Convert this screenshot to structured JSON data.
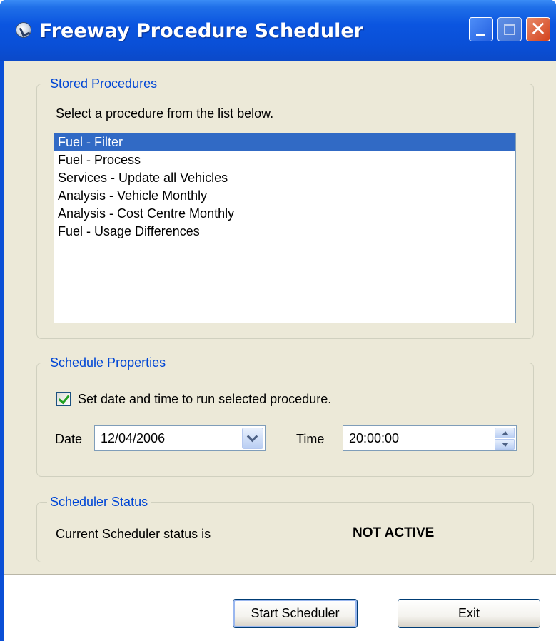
{
  "window": {
    "title": "Freeway Procedure Scheduler",
    "icon": "app-icon",
    "controls": {
      "minimize": "minimize-icon",
      "maximize": "maximize-icon",
      "close": "✕"
    }
  },
  "stored_procedures": {
    "legend": "Stored Procedures",
    "instruction": "Select a procedure from the list below.",
    "items": [
      "Fuel - Filter",
      "Fuel - Process",
      "Services - Update all Vehicles",
      "Analysis - Vehicle Monthly",
      "Analysis - Cost Centre Monthly",
      "Fuel - Usage Differences"
    ],
    "selected_index": 0
  },
  "schedule_properties": {
    "legend": "Schedule Properties",
    "checkbox_label": "Set date and time to run selected procedure.",
    "checkbox_checked": true,
    "date_label": "Date",
    "date_value": "12/04/2006",
    "time_label": "Time",
    "time_value": "20:00:00"
  },
  "scheduler_status": {
    "legend": "Scheduler Status",
    "label": "Current Scheduler status is",
    "value": "NOT ACTIVE"
  },
  "buttons": {
    "start": "Start Scheduler",
    "exit": "Exit"
  },
  "colors": {
    "titlebar": "#0a4fd6",
    "legend_text": "#0046d5",
    "selection": "#316ac5",
    "dialog_bg": "#ece9d8"
  }
}
